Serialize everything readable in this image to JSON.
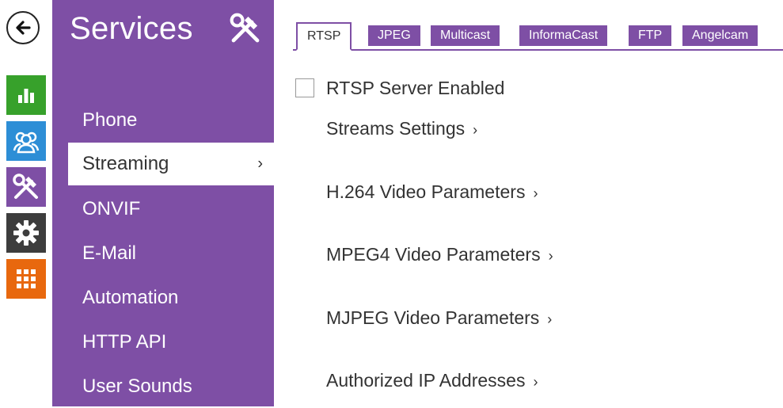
{
  "colors": {
    "accent": "#7e4fa5",
    "green": "#37a12b",
    "blue": "#2d8ed6",
    "purple": "#7e4fa5",
    "dark": "#3d3d3d",
    "orange": "#e8680e"
  },
  "rail": {
    "back_icon": "back-arrow-icon",
    "tiles": [
      {
        "name": "status",
        "icon": "bar-chart-icon",
        "color": "#37a12b"
      },
      {
        "name": "directory",
        "icon": "users-icon",
        "color": "#2d8ed6"
      },
      {
        "name": "services",
        "icon": "tools-icon",
        "color": "#7e4fa5"
      },
      {
        "name": "hardware",
        "icon": "gear-icon",
        "color": "#3d3d3d"
      },
      {
        "name": "system",
        "icon": "grid-icon",
        "color": "#e8680e"
      }
    ]
  },
  "panel": {
    "title": "Services",
    "title_icon": "tools-icon",
    "items": [
      {
        "label": "Phone"
      },
      {
        "label": "Streaming",
        "active": true,
        "chevron": "›"
      },
      {
        "label": "ONVIF"
      },
      {
        "label": "E-Mail"
      },
      {
        "label": "Automation"
      },
      {
        "label": "HTTP API"
      },
      {
        "label": "User Sounds"
      }
    ]
  },
  "tabs": [
    {
      "label": "RTSP",
      "active": true
    },
    {
      "label": "JPEG"
    },
    {
      "label": "Multicast"
    },
    {
      "label": "InformaCast"
    },
    {
      "label": "FTP"
    },
    {
      "label": "Angelcam"
    }
  ],
  "content": {
    "rtsp_server_enabled": {
      "label": "RTSP Server Enabled",
      "checked": false
    },
    "sections": [
      {
        "label": "Streams Settings",
        "chevron": "›"
      },
      {
        "label": "H.264 Video Parameters",
        "chevron": "›"
      },
      {
        "label": "MPEG4 Video Parameters",
        "chevron": "›"
      },
      {
        "label": "MJPEG Video Parameters",
        "chevron": "›"
      },
      {
        "label": "Authorized IP Addresses",
        "chevron": "›"
      }
    ]
  }
}
